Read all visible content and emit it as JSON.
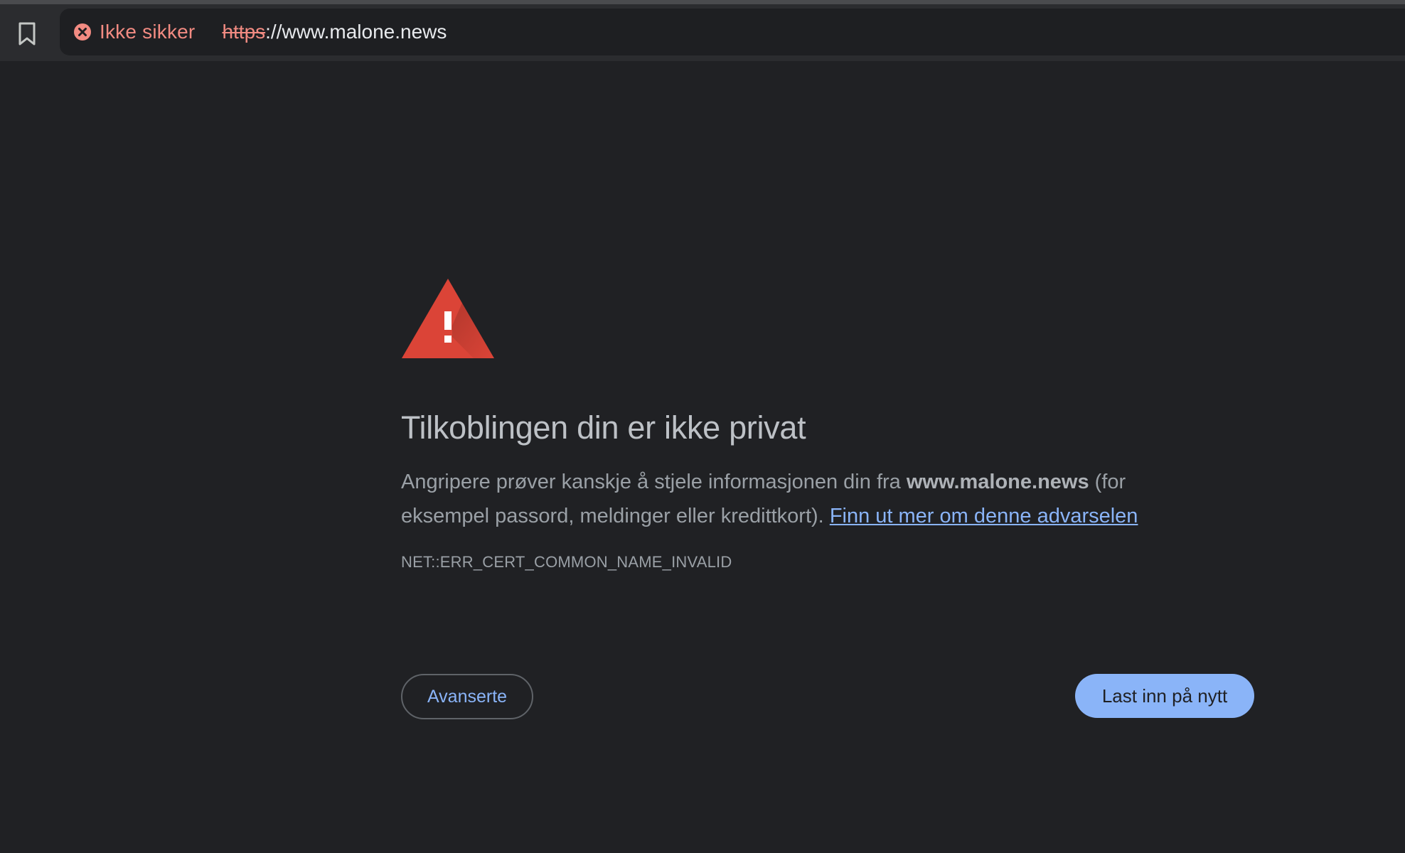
{
  "browser": {
    "bookmark_icon": "bookmark-icon",
    "security_icon": "error-circle-x-icon",
    "security_label": "Ikke sikker",
    "url_scheme": "https",
    "url_rest": "://www.malone.news"
  },
  "interstitial": {
    "icon": "warning-triangle-icon",
    "heading": "Tilkoblingen din er ikke privat",
    "body_before": "Angripere prøver kanskje å stjele informasjonen din fra ",
    "body_domain": "www.malone.news",
    "body_after": " (for eksempel passord, meldinger eller kredittkort). ",
    "learn_more_link": "Finn ut mer om denne advarselen",
    "error_code": "NET::ERR_CERT_COMMON_NAME_INVALID",
    "advanced_button": "Avanserte",
    "reload_button": "Last inn på nytt"
  },
  "colors": {
    "background": "#202124",
    "warning_red": "#db4437",
    "danger_text": "#f28b82",
    "link_blue": "#8ab4f8"
  }
}
